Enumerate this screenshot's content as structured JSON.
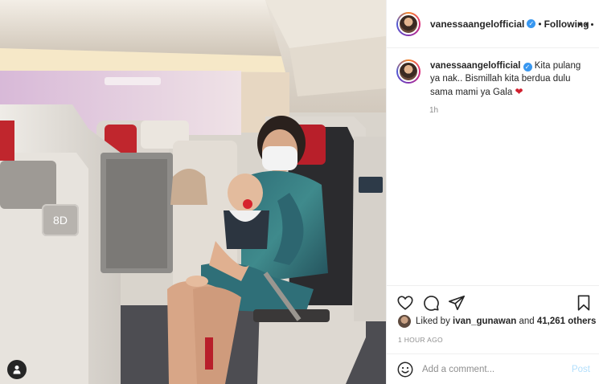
{
  "photo": {
    "seat_label": "8D",
    "user_tags_icon": "person-icon"
  },
  "header": {
    "username": "vanessaangelofficial",
    "separator": "•",
    "follow_status": "Following",
    "more_icon": "more-horizontal-icon"
  },
  "caption": {
    "username": "vanessaangelofficial",
    "text": "Kita pulang ya nak.. Bismillah kita berdua dulu sama mami ya Gala",
    "emoji": "❤",
    "time": "1h"
  },
  "actions": {
    "like_icon": "heart-icon",
    "comment_icon": "comment-icon",
    "share_icon": "share-icon",
    "save_icon": "bookmark-icon"
  },
  "likes": {
    "prefix": "Liked by",
    "user": "ivan_gunawan",
    "middle": "and",
    "count": "41,261 others"
  },
  "time_ago": "1 HOUR AGO",
  "comment": {
    "placeholder": "Add a comment...",
    "post_label": "Post",
    "emoji_icon": "smiley-icon"
  },
  "colors": {
    "verified": "#3897f0",
    "post_disabled": "#b2dffc",
    "secondary_text": "#8e8e8e",
    "heart": "#d11f2e"
  }
}
